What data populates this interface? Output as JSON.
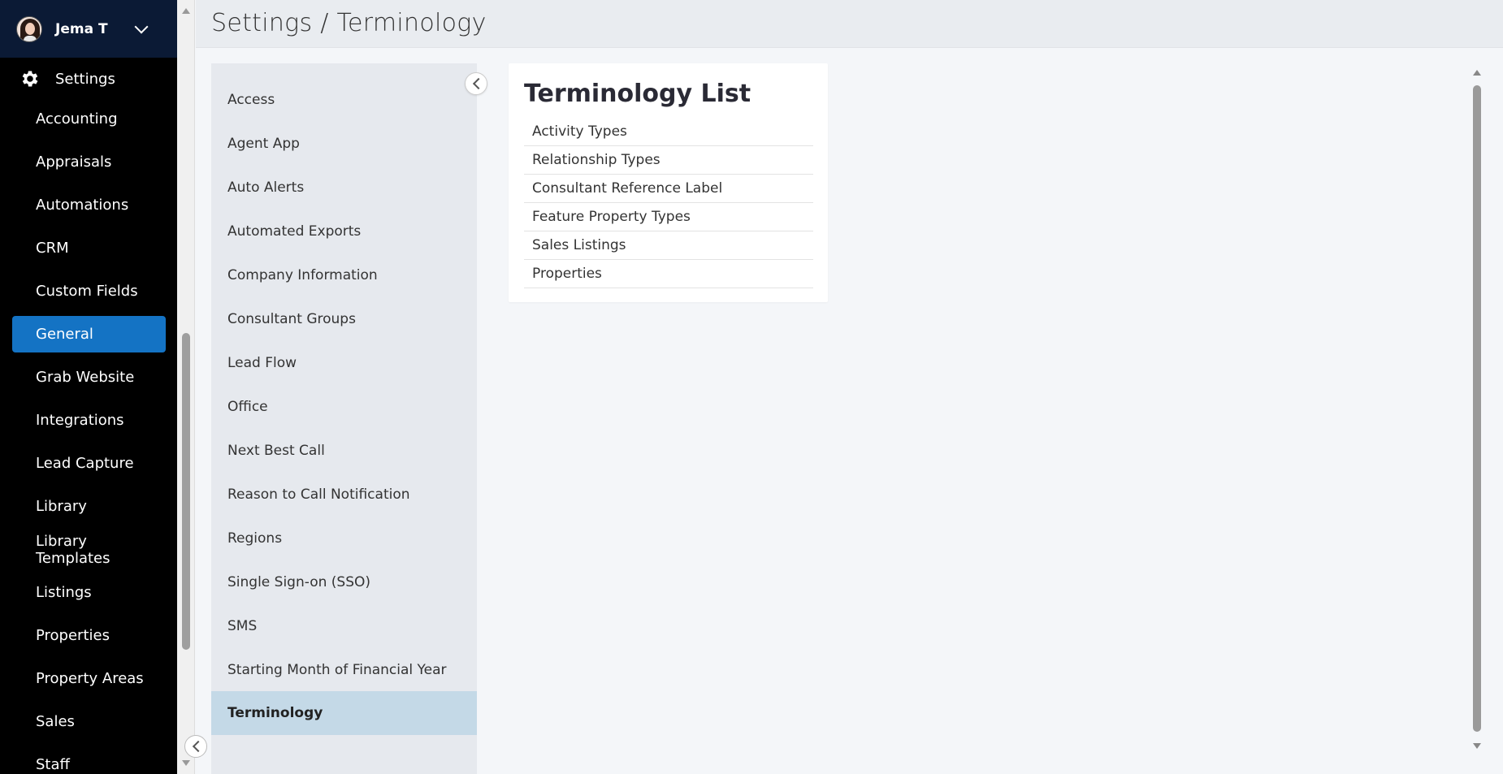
{
  "user": {
    "name": "Jema T"
  },
  "sidebar": {
    "settings_label": "Settings",
    "items": [
      {
        "label": "Accounting"
      },
      {
        "label": "Appraisals"
      },
      {
        "label": "Automations"
      },
      {
        "label": "CRM"
      },
      {
        "label": "Custom Fields"
      },
      {
        "label": "General",
        "active": true
      },
      {
        "label": "Grab Website"
      },
      {
        "label": "Integrations"
      },
      {
        "label": "Lead Capture"
      },
      {
        "label": "Library"
      },
      {
        "label": "Library Templates"
      },
      {
        "label": "Listings"
      },
      {
        "label": "Properties"
      },
      {
        "label": "Property Areas"
      },
      {
        "label": "Sales"
      },
      {
        "label": "Staff"
      }
    ]
  },
  "header": {
    "title": "Settings / Terminology"
  },
  "submenu": {
    "items": [
      {
        "label": "Access"
      },
      {
        "label": "Agent App"
      },
      {
        "label": "Auto Alerts"
      },
      {
        "label": "Automated Exports"
      },
      {
        "label": "Company Information"
      },
      {
        "label": "Consultant Groups"
      },
      {
        "label": "Lead Flow"
      },
      {
        "label": "Office"
      },
      {
        "label": "Next Best Call"
      },
      {
        "label": "Reason to Call Notification"
      },
      {
        "label": "Regions"
      },
      {
        "label": "Single Sign-on (SSO)"
      },
      {
        "label": "SMS"
      },
      {
        "label": "Starting Month of Financial Year"
      },
      {
        "label": "Terminology",
        "active": true
      }
    ]
  },
  "card": {
    "title": "Terminology List",
    "items": [
      {
        "label": "Activity Types"
      },
      {
        "label": "Relationship Types"
      },
      {
        "label": "Consultant Reference Label"
      },
      {
        "label": "Feature Property Types"
      },
      {
        "label": "Sales Listings"
      },
      {
        "label": "Properties"
      }
    ]
  },
  "colors": {
    "sidebar_bg": "#000000",
    "user_bar_bg": "#0b1a35",
    "active_nav": "#1473c4",
    "active_submenu": "#c4d9e7",
    "submenu_bg": "#e6e9ee"
  }
}
